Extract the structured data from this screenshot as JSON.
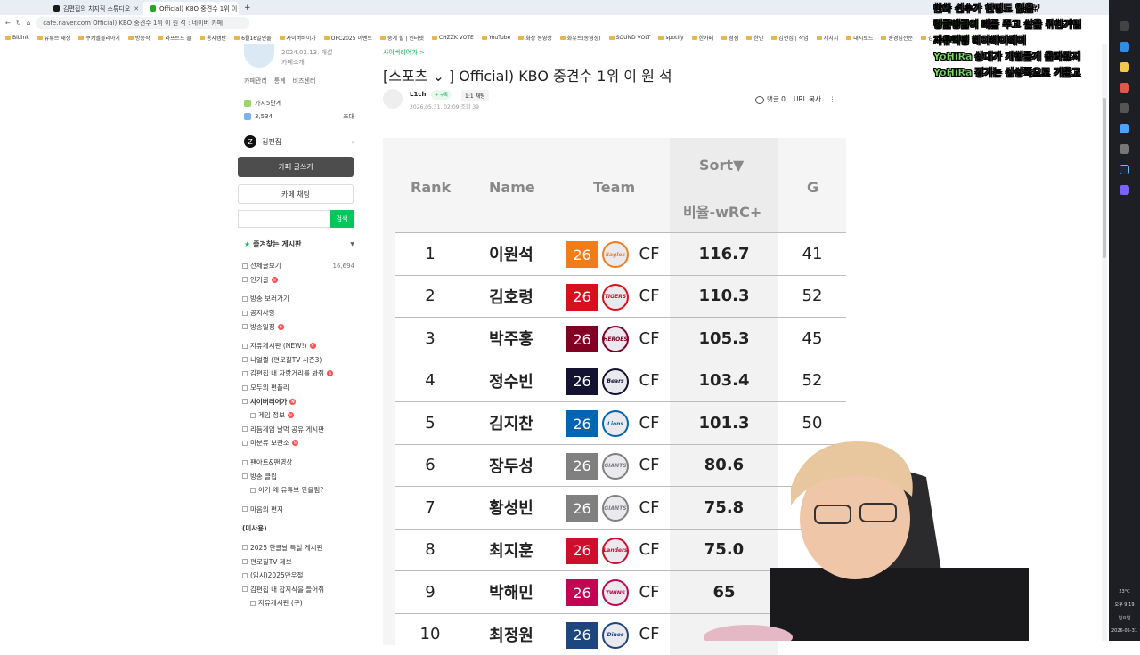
{
  "browser": {
    "tabs": [
      {
        "title": "김편집의 치지직 스튜디오",
        "active": false
      },
      {
        "title": "Official) KBO 중견수 1위 이 원 석",
        "active": true
      }
    ],
    "url": "cafe.naver.com  Official) KBO 중견수 1위 이 원 석 : 네이버 카페",
    "bookmarks": [
      "Bitlink",
      "유튜브 재생",
      "쿠키멜블리아기",
      "방송작",
      "라프트프 클",
      "옹자캠탄",
      "6월16일인물",
      "사이버비이가",
      "OPC2025 이벤트",
      "중계 할 | 인터넷",
      "CHZZK VOTE",
      "YouTube",
      "화장 동영상",
      "화유트(동영상)",
      "SOUND VOLT",
      "spotify",
      "한카페",
      "점점",
      "한인",
      "김편집 | 작업",
      "지치치",
      "대시보드",
      "총경님전문",
      "김편집 장제"
    ]
  },
  "sidebar": {
    "cafe_date": "2024.02.13. 개설",
    "cafe_intro": "카페소개",
    "links": [
      "카페관리",
      "통계",
      "비즈센터"
    ],
    "level": "가지5단계",
    "members": "3,534",
    "invite": "초대",
    "manager": "김편집",
    "manager_icon": "Z",
    "write_button": "카페 글쓰기",
    "chat_button": "카페 채팅",
    "search_button": "검색",
    "favorites": "즐겨찾는 게시판",
    "menu": [
      {
        "label": "전체글보기",
        "count": "16,694"
      },
      {
        "label": "인기글",
        "new": true
      },
      {
        "label": "방송 보러가기",
        "gap": true
      },
      {
        "label": "공지사항"
      },
      {
        "label": "방송일정",
        "new": true
      },
      {
        "label": "자유게시판 (NEW!)",
        "new": true,
        "gap": true
      },
      {
        "label": "니얼껄 (편로칠TV 시즌3)"
      },
      {
        "label": "김편집 내 자랑거리를 봐줘",
        "new": true
      },
      {
        "label": "모두의 편플리"
      },
      {
        "label": "사이버리어가",
        "new": true,
        "bold": true
      },
      {
        "label": "게임 정보",
        "new": true,
        "sub": true
      },
      {
        "label": "리듬게임 날먹 공유 게시판"
      },
      {
        "label": "미분류 보관소",
        "new": true
      },
      {
        "label": "팬아트&팬영상",
        "gap": true
      },
      {
        "label": "방송 클립"
      },
      {
        "label": "이거 왜 유튜브 안올림?",
        "sub": true
      },
      {
        "label": "마음의 편지",
        "gap": true
      },
      {
        "label": "(미사용)",
        "gap": true,
        "bold": true,
        "nobox": true
      },
      {
        "label": "2025 한글날 특설 게시판",
        "gap": true
      },
      {
        "label": "편로칠TV 제보"
      },
      {
        "label": "(임시)2025만우절"
      },
      {
        "label": "김편집 내 잡지식을 들어줘"
      },
      {
        "label": "자유게시판 (구)",
        "sub": true
      }
    ]
  },
  "article": {
    "board": "사이버리어가 >",
    "title": "[스포츠 ⌄ ] Official) KBO 중견수 1위 이 원 석",
    "author": "L1ch",
    "subscribe": "+ 구독",
    "chat_badge": "1:1 채팅",
    "date": "2026.05.31. 02:09  조회 39",
    "comments": "댓글 0",
    "copy_url": "URL 복사"
  },
  "table": {
    "headers": {
      "rank": "Rank",
      "name": "Name",
      "team": "Team",
      "sort": "Sort▼",
      "stat": "비율-wRC+",
      "g": "G"
    },
    "rows": [
      {
        "rank": "1",
        "name": "이원석",
        "year": "26",
        "team_logo": "Eagles",
        "pos": "CF",
        "stat": "116.7",
        "g": "41",
        "color": "#ef7d1a"
      },
      {
        "rank": "2",
        "name": "김호령",
        "year": "26",
        "team_logo": "TIGERS",
        "pos": "CF",
        "stat": "110.3",
        "g": "52",
        "color": "#d4111c"
      },
      {
        "rank": "3",
        "name": "박주홍",
        "year": "26",
        "team_logo": "HEROES",
        "pos": "CF",
        "stat": "105.3",
        "g": "45",
        "color": "#820024"
      },
      {
        "rank": "4",
        "name": "정수빈",
        "year": "26",
        "team_logo": "Bears",
        "pos": "CF",
        "stat": "103.4",
        "g": "52",
        "color": "#131230"
      },
      {
        "rank": "5",
        "name": "김지찬",
        "year": "26",
        "team_logo": "Lions",
        "pos": "CF",
        "stat": "101.3",
        "g": "50",
        "color": "#0066b3"
      },
      {
        "rank": "6",
        "name": "장두성",
        "year": "26",
        "team_logo": "GIANTS",
        "pos": "CF",
        "stat": "80.6",
        "g": "",
        "color": "#808080"
      },
      {
        "rank": "7",
        "name": "황성빈",
        "year": "26",
        "team_logo": "GIANTS",
        "pos": "CF",
        "stat": "75.8",
        "g": "",
        "color": "#808080"
      },
      {
        "rank": "8",
        "name": "최지훈",
        "year": "26",
        "team_logo": "Landers",
        "pos": "CF",
        "stat": "75.0",
        "g": "",
        "color": "#ce0e2d"
      },
      {
        "rank": "9",
        "name": "박해민",
        "year": "26",
        "team_logo": "TWINS",
        "pos": "CF",
        "stat": "65",
        "g": "",
        "color": "#c30452"
      },
      {
        "rank": "10",
        "name": "최정원",
        "year": "26",
        "team_logo": "Dinos",
        "pos": "CF",
        "stat": "",
        "g": "",
        "color": "#1d467e"
      }
    ]
  },
  "chat": [
    {
      "user": "",
      "msg": "한화 선수가 한명도 없음?"
    },
    {
      "user": "링글벵글이",
      "msg": "빼들 주고 살을 위한거임"
    },
    {
      "user": "자유억빙",
      "msg": "헤이헤이헤이"
    },
    {
      "user": "YoHiRa",
      "msg": "상대가 개힘들게 올라왔지"
    },
    {
      "user": "YoHiRa",
      "msg": "경기는 삼성쪽으로 기울고"
    }
  ],
  "tray": {
    "weather": "23°C",
    "time": "오후 9:19",
    "day": "일요일",
    "date": "2026-05-31"
  }
}
